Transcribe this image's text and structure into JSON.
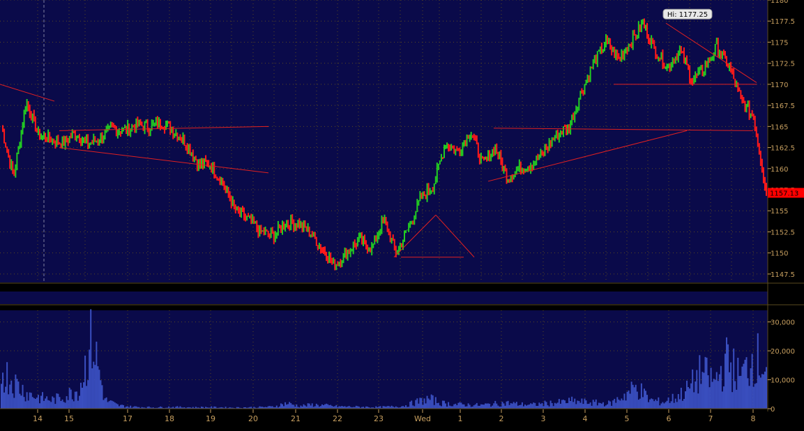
{
  "colors": {
    "background": "#0a0a4a",
    "grid": "#5a4a20",
    "axis_text": "#c8a060",
    "up": "#22cc22",
    "down": "#ff1a1a",
    "trendline": "#e02020",
    "volume": "#3a4fc0",
    "last_price_bg": "#ff0000"
  },
  "chart_data": [
    {
      "type": "line",
      "role": "price",
      "x": [
        "14",
        "15",
        "17",
        "18",
        "19",
        "20",
        "21",
        "22",
        "23",
        "Wed",
        "1",
        "2",
        "3",
        "4",
        "5",
        "6",
        "7",
        "8"
      ],
      "y_ticks": [
        "1147.5",
        "1150",
        "1152.5",
        "1155",
        "1157.5",
        "1160",
        "1162.5",
        "1165",
        "1167.5",
        "1170",
        "1172.5",
        "1175",
        "1177.5",
        "1180"
      ],
      "ylim": [
        1146.5,
        1180
      ],
      "series": [
        {
          "values": [
            1165.0,
            1159.0,
            1168.0,
            1164.0,
            1163.5,
            1163.0,
            1164.2,
            1163.0,
            1163.5,
            1164.8,
            1164.5,
            1165.2,
            1165.0,
            1165.5,
            1164.5,
            1163.0,
            1160.5,
            1160.5,
            1158.0,
            1155.0,
            1154.0,
            1152.5,
            1152.0,
            1153.5,
            1153.5,
            1152.5,
            1150.5,
            1148.5,
            1150.0,
            1151.5,
            1150.5,
            1154.0,
            1150.0,
            1153.0,
            1156.5,
            1158.0,
            1163.0,
            1162.0,
            1164.5,
            1160.5,
            1162.5,
            1159.0,
            1160.0,
            1160.5,
            1162.0,
            1164.0,
            1165.0,
            1169.0,
            1172.5,
            1175.0,
            1173.0,
            1175.0,
            1177.25,
            1174.0,
            1172.0,
            1174.0,
            1170.5,
            1172.0,
            1174.5,
            1172.0,
            1168.0,
            1166.0,
            1157.13
          ]
        }
      ],
      "annotations": {
        "high_label": "Hi: 1177.25",
        "last_price": "1157.13"
      },
      "grid": true
    },
    {
      "type": "bar",
      "role": "volume",
      "y_ticks": [
        "0",
        "10,000",
        "20,000",
        "30,000"
      ],
      "ylim": [
        0,
        34000
      ],
      "series": [
        {
          "values": [
            18000,
            12000,
            7000,
            5000,
            4000,
            6000,
            9000,
            32000,
            4000,
            1500,
            900,
            700,
            600,
            800,
            700,
            600,
            700,
            600,
            500,
            600,
            700,
            900,
            2500,
            1200,
            1800,
            1500,
            1000,
            900,
            800,
            700,
            900,
            1200,
            3000,
            4500,
            2500,
            2000,
            1800,
            1600,
            2200,
            2600,
            2000,
            1800,
            2400,
            2800,
            3500,
            3000,
            2600,
            2400,
            6000,
            10000,
            4000,
            3000,
            5000,
            9000,
            17000,
            12000,
            22000,
            14000,
            24000,
            20000
          ]
        }
      ],
      "grid": true
    }
  ]
}
